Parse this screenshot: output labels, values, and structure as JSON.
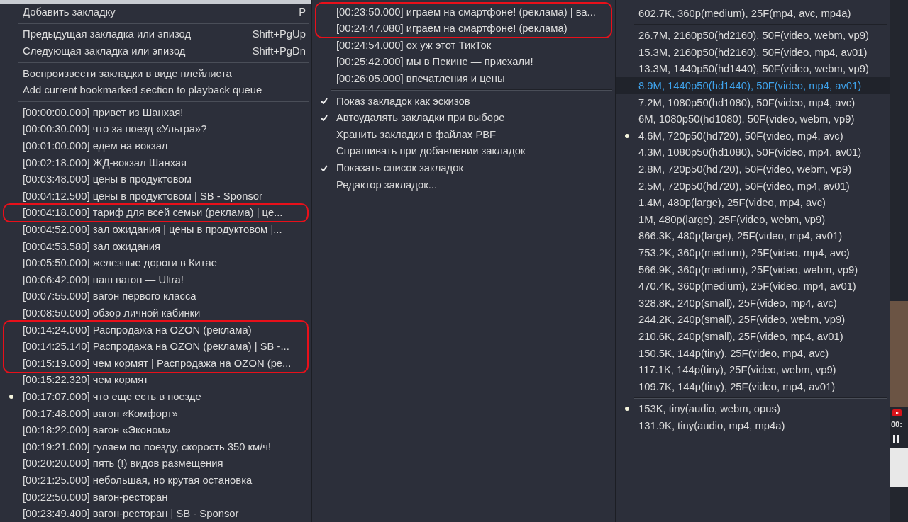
{
  "bookmarks_menu": {
    "sections": [
      {
        "entries": [
          {
            "kind": "command",
            "label": "Добавить закладку",
            "shortcut": "P"
          }
        ]
      },
      {
        "entries": [
          {
            "kind": "command",
            "label": "Предыдущая закладка или эпизод",
            "shortcut": "Shift+PgUp"
          },
          {
            "kind": "command",
            "label": "Следующая закладка или эпизод",
            "shortcut": "Shift+PgDn"
          }
        ]
      },
      {
        "entries": [
          {
            "kind": "command",
            "label": "Воспроизвести закладки в виде плейлиста"
          },
          {
            "kind": "command",
            "label": "Add current bookmarked section to playback queue"
          }
        ]
      },
      {
        "entries": [
          {
            "kind": "bookmark",
            "label": "[00:00:00.000] привет из Шанхая!",
            "selected": false
          },
          {
            "kind": "bookmark",
            "label": "[00:00:30.000] что за поезд «Ультра»?",
            "selected": false
          },
          {
            "kind": "bookmark",
            "label": "[00:01:00.000] едем на вокзал",
            "selected": false
          },
          {
            "kind": "bookmark",
            "label": "[00:02:18.000] ЖД-вокзал Шанхая",
            "selected": false
          },
          {
            "kind": "bookmark",
            "label": "[00:03:48.000] цены в продуктовом",
            "selected": false
          },
          {
            "kind": "bookmark",
            "label": "[00:04:12.500] цены в продуктовом | SB - Sponsor",
            "selected": false
          },
          {
            "kind": "outline",
            "items": [
              {
                "kind": "bookmark",
                "label": "[00:04:18.000] тариф для всей семьи (реклама) | це...",
                "selected": false
              }
            ]
          },
          {
            "kind": "bookmark",
            "label": "[00:04:52.000] зал ожидания | цены в продуктовом |...",
            "selected": false
          },
          {
            "kind": "bookmark",
            "label": "[00:04:53.580] зал ожидания",
            "selected": false
          },
          {
            "kind": "bookmark",
            "label": "[00:05:50.000] железные дороги в Китае",
            "selected": false
          },
          {
            "kind": "bookmark",
            "label": "[00:06:42.000] наш вагон — Ultra!",
            "selected": false
          },
          {
            "kind": "bookmark",
            "label": "[00:07:55.000] вагон первого класса",
            "selected": false
          },
          {
            "kind": "bookmark",
            "label": "[00:08:50.000] обзор личной кабинки",
            "selected": false
          },
          {
            "kind": "outline",
            "items": [
              {
                "kind": "bookmark",
                "label": "[00:14:24.000] Распродажа на OZON (реклама)",
                "selected": false
              },
              {
                "kind": "bookmark",
                "label": "[00:14:25.140] Распродажа на OZON (реклама) | SB -...",
                "selected": false
              },
              {
                "kind": "bookmark",
                "label": "[00:15:19.000] чем кормят | Распродажа на OZON (ре...",
                "selected": false
              }
            ]
          },
          {
            "kind": "bookmark",
            "label": "[00:15:22.320] чем кормят",
            "selected": false
          },
          {
            "kind": "bookmark",
            "label": "[00:17:07.000] что еще есть в поезде",
            "selected": true
          },
          {
            "kind": "bookmark",
            "label": "[00:17:48.000] вагон «Комфорт»",
            "selected": false
          },
          {
            "kind": "bookmark",
            "label": "[00:18:22.000] вагон «Эконом»",
            "selected": false
          },
          {
            "kind": "bookmark",
            "label": "[00:19:21.000] гуляем по поезду, скорость 350 км/ч!",
            "selected": false
          },
          {
            "kind": "bookmark",
            "label": "[00:20:20.000] пять (!) видов размещения",
            "selected": false
          },
          {
            "kind": "bookmark",
            "label": "[00:21:25.000] небольшая, но крутая остановка",
            "selected": false
          },
          {
            "kind": "bookmark",
            "label": "[00:22:50.000] вагон-ресторан",
            "selected": false
          },
          {
            "kind": "bookmark",
            "label": "[00:23:49.400] вагон-ресторан | SB - Sponsor",
            "selected": false
          }
        ]
      }
    ]
  },
  "bookmarks_menu_continued": {
    "sections": [
      {
        "entries": [
          {
            "kind": "outline",
            "items": [
              {
                "kind": "bookmark",
                "label": "[00:23:50.000] играем на смартфоне! (реклама) | ва...",
                "selected": false
              },
              {
                "kind": "bookmark",
                "label": "[00:24:47.080] играем на смартфоне! (реклама)",
                "selected": false
              }
            ]
          },
          {
            "kind": "bookmark",
            "label": "[00:24:54.000] ох уж этот ТикТок",
            "selected": false
          },
          {
            "kind": "bookmark",
            "label": "[00:25:42.000] мы в Пекине — приехали!",
            "selected": false
          },
          {
            "kind": "bookmark",
            "label": "[00:26:05.000] впечатления и цены",
            "selected": false
          }
        ]
      },
      {
        "entries": [
          {
            "kind": "check",
            "label": "Показ закладок как эскизов",
            "checked": true
          },
          {
            "kind": "check",
            "label": "Автоудалять закладки при выборе",
            "checked": true
          },
          {
            "kind": "check",
            "label": "Хранить закладки в файлах PBF",
            "checked": false
          },
          {
            "kind": "check",
            "label": "Спрашивать при добавлении закладок",
            "checked": false
          },
          {
            "kind": "check",
            "label": "Показать список закладок",
            "checked": true
          },
          {
            "kind": "command",
            "label": "Редактор закладок..."
          }
        ]
      }
    ]
  },
  "formats_menu": {
    "sections": [
      {
        "entries": [
          {
            "kind": "format",
            "label": "602.7K, 360p(medium), 25F(mp4, avc, mp4a)",
            "selected": false,
            "highlighted": false
          }
        ]
      },
      {
        "entries": [
          {
            "kind": "format",
            "label": "26.7M, 2160p50(hd2160), 50F(video, webm, vp9)",
            "selected": false,
            "highlighted": false
          },
          {
            "kind": "format",
            "label": "15.3M, 2160p50(hd2160), 50F(video, mp4, av01)",
            "selected": false,
            "highlighted": false
          },
          {
            "kind": "format",
            "label": "13.3M, 1440p50(hd1440), 50F(video, webm, vp9)",
            "selected": false,
            "highlighted": false
          },
          {
            "kind": "format",
            "label": "8.9M, 1440p50(hd1440), 50F(video, mp4, av01)",
            "selected": false,
            "highlighted": true
          },
          {
            "kind": "format",
            "label": "7.2M, 1080p50(hd1080), 50F(video, mp4, avc)",
            "selected": false,
            "highlighted": false
          },
          {
            "kind": "format",
            "label": "6M, 1080p50(hd1080), 50F(video, webm, vp9)",
            "selected": false,
            "highlighted": false
          },
          {
            "kind": "format",
            "label": "4.6M, 720p50(hd720), 50F(video, mp4, avc)",
            "selected": true,
            "highlighted": false
          },
          {
            "kind": "format",
            "label": "4.3M, 1080p50(hd1080), 50F(video, mp4, av01)",
            "selected": false,
            "highlighted": false
          },
          {
            "kind": "format",
            "label": "2.8M, 720p50(hd720), 50F(video, webm, vp9)",
            "selected": false,
            "highlighted": false
          },
          {
            "kind": "format",
            "label": "2.5M, 720p50(hd720), 50F(video, mp4, av01)",
            "selected": false,
            "highlighted": false
          },
          {
            "kind": "format",
            "label": "1.4M, 480p(large), 25F(video, mp4, avc)",
            "selected": false,
            "highlighted": false
          },
          {
            "kind": "format",
            "label": "1M, 480p(large), 25F(video, webm, vp9)",
            "selected": false,
            "highlighted": false
          },
          {
            "kind": "format",
            "label": "866.3K, 480p(large), 25F(video, mp4, av01)",
            "selected": false,
            "highlighted": false
          },
          {
            "kind": "format",
            "label": "753.2K, 360p(medium), 25F(video, mp4, avc)",
            "selected": false,
            "highlighted": false
          },
          {
            "kind": "format",
            "label": "566.9K, 360p(medium), 25F(video, webm, vp9)",
            "selected": false,
            "highlighted": false
          },
          {
            "kind": "format",
            "label": "470.4K, 360p(medium), 25F(video, mp4, av01)",
            "selected": false,
            "highlighted": false
          },
          {
            "kind": "format",
            "label": "328.8K, 240p(small), 25F(video, mp4, avc)",
            "selected": false,
            "highlighted": false
          },
          {
            "kind": "format",
            "label": "244.2K, 240p(small), 25F(video, webm, vp9)",
            "selected": false,
            "highlighted": false
          },
          {
            "kind": "format",
            "label": "210.6K, 240p(small), 25F(video, mp4, av01)",
            "selected": false,
            "highlighted": false
          },
          {
            "kind": "format",
            "label": "150.5K, 144p(tiny), 25F(video, mp4, avc)",
            "selected": false,
            "highlighted": false
          },
          {
            "kind": "format",
            "label": "117.1K, 144p(tiny), 25F(video, webm, vp9)",
            "selected": false,
            "highlighted": false
          },
          {
            "kind": "format",
            "label": "109.7K, 144p(tiny), 25F(video, mp4, av01)",
            "selected": false,
            "highlighted": false
          }
        ]
      },
      {
        "entries": [
          {
            "kind": "format",
            "label": "153K, tiny(audio, webm, opus)",
            "selected": true,
            "highlighted": false
          },
          {
            "kind": "format",
            "label": "131.9K, tiny(audio, mp4, mp4a)",
            "selected": false,
            "highlighted": false
          }
        ]
      }
    ]
  },
  "player": {
    "time": "00:"
  }
}
